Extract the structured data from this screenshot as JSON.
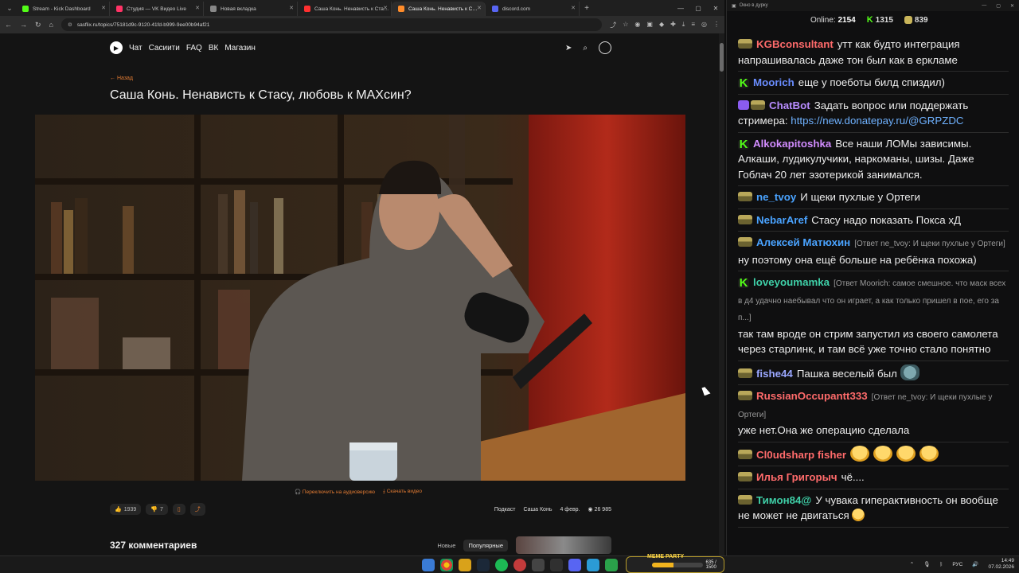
{
  "browser": {
    "tabs": [
      {
        "title": "Stream - Kick Dashboard",
        "color": "#53fc18"
      },
      {
        "title": "Студия — VK Видео Live",
        "color": "#ff3366"
      },
      {
        "title": "Новая вкладка",
        "color": "#888888"
      },
      {
        "title": "Саша Конь. Ненависть к Ста…",
        "color": "#ff3030"
      },
      {
        "title": "Саша Конь. Ненависть к С…",
        "color": "#ff8c2a"
      },
      {
        "title": "discord.com",
        "color": "#5865f2"
      }
    ],
    "url": "sasflix.ru/topics/75181d9c-9120-41fd-b999-9ee00b94af21"
  },
  "site": {
    "nav": [
      "Чат",
      "Сасиити",
      "FAQ",
      "ВК",
      "Магазин"
    ],
    "back_label": "← Назад",
    "title": "Саша Конь. Ненависть к Стасу, любовь к МАХсин?",
    "audio_link": "Переключить на аудиоверсию",
    "download_link": "Скачать видео",
    "likes": "1939",
    "dislikes": "7",
    "tag_podcast": "Подкаст",
    "tag_author": "Саша Конь",
    "date": "4 февр.",
    "views": "26 985",
    "comments_count": "327 комментариев",
    "sort_new": "Новые",
    "sort_popular": "Популярные"
  },
  "chat": {
    "window_title": "Окно в дурку",
    "online_label": "Online:",
    "online_value": "2154",
    "kick_count": "1315",
    "other_count": "839",
    "messages": [
      {
        "badge": "pepe",
        "user": "KGBconsultant",
        "color": "#ff6b6b",
        "reply": "",
        "text": "утт как будто интеграция напрашивалась даже тон был как в еркламе"
      },
      {
        "badge": "kick",
        "user": "Moorich",
        "color": "#6a8dff",
        "reply": "",
        "text": "еще у поеботы билд спиздил)"
      },
      {
        "badge": "bot",
        "user": "ChatBot",
        "color": "#b88cff",
        "reply": "",
        "text": "Задать вопрос или поддержать стримера:",
        "link": "https://new.donatepay.ru/@GRPZDC"
      },
      {
        "badge": "kick",
        "user": "Alkokapitoshka",
        "color": "#d28cff",
        "reply": "",
        "text": "Все наши ЛОМы зависимы. Алкаши, лудикулучики, наркоманы, шизы. Даже Гоблач 20 лет эзотерикой занимался."
      },
      {
        "badge": "pepe",
        "user": "ne_tvoy",
        "color": "#4aa3ff",
        "reply": "",
        "text": "И щеки пухлые у Ортеги"
      },
      {
        "badge": "pepe",
        "user": "NebarAref",
        "color": "#4aa3ff",
        "reply": "",
        "text": "Стасу надо показать Покса хД"
      },
      {
        "badge": "pepe",
        "user": "Алексей Матюхин",
        "color": "#4aa3ff",
        "reply": "[Ответ ne_tvoy: И щеки пухлые у Ортеги]",
        "text": "ну поэтому она ещё больше на ребёнка похожа)"
      },
      {
        "badge": "kick",
        "user": "loveyoumamka",
        "color": "#3fd0a8",
        "reply": "[Ответ Moorich: самое смешное. что маск всех в д4 удачно наебывал что он играет, а как только пришел в пое, его за п...]",
        "text": "так там вроде он стрим запустил из своего самолета через старлинк, и там всё уже точно стало понятно"
      },
      {
        "badge": "pepe",
        "user": "fishe44",
        "color": "#9aa7ff",
        "reply": "",
        "text": "Пашка веселый был",
        "emotes": 1,
        "emote_kind": "fish"
      },
      {
        "badge": "pepe",
        "user": "RussianOccupantt333",
        "color": "#ff6b6b",
        "reply": "[Ответ ne_tvoy: И щеки пухлые у Ортеги]",
        "text": "уже нет.Она же операцию сделала"
      },
      {
        "badge": "pepe",
        "user": "Cl0udsharp fisher",
        "color": "#ff6b6b",
        "reply": "",
        "text": "",
        "emotes": 4,
        "emote_kind": "laugh"
      },
      {
        "badge": "pepe",
        "user": "Илья Григорыч",
        "color": "#ff6b6b",
        "reply": "",
        "text": "чё...."
      },
      {
        "badge": "pepe",
        "user": "Тимон84@",
        "color": "#3fd0a8",
        "reply": "",
        "text": "У чувака гиперактивность он вообще не может не двигаться",
        "emotes": 1,
        "emote_kind": "small"
      }
    ]
  },
  "taskbar": {
    "meme_title": "MEME PARTY",
    "meme_progress": "635 / 1500",
    "meme_fraction": 0.42,
    "lang": "РУС",
    "time": "14:49",
    "date": "07.02.2026"
  }
}
